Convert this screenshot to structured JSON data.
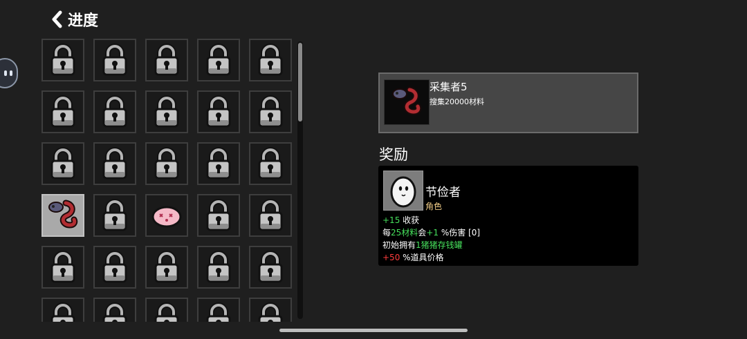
{
  "header": {
    "back_icon": "chevron-left-icon",
    "title": "进度"
  },
  "colors": {
    "background": "#1f1f1f",
    "positive": "#46e05c",
    "negative": "#ff3c3c",
    "type_label": "#f0cc87"
  },
  "grid": {
    "columns": 5,
    "cells": [
      "locked",
      "locked",
      "locked",
      "locked",
      "locked",
      "locked",
      "locked",
      "locked",
      "locked",
      "locked",
      "locked",
      "locked",
      "locked",
      "locked",
      "locked",
      "unlocked-tentacle",
      "locked",
      "unlocked-pink-creature",
      "locked",
      "locked",
      "locked",
      "locked",
      "locked",
      "locked",
      "locked",
      "locked",
      "locked",
      "locked",
      "locked",
      "locked"
    ]
  },
  "achievement": {
    "icon": "red-tentacle-icon",
    "name": "采集者5",
    "desc": "搜集20000材料"
  },
  "reward": {
    "heading": "奖励",
    "icon": "white-egg-character-icon",
    "name": "节俭者",
    "type": "角色",
    "stat1": {
      "value": "+15",
      "text": " 收获"
    },
    "stat2": {
      "t1": "每",
      "v1": "25材料",
      "t2": "会",
      "v2": "+1",
      "t3": " %伤害 [0]"
    },
    "stat3": {
      "t1": "初始拥有",
      "v1": "1猪猪存钱罐"
    },
    "stat4": {
      "value": "+50",
      "text": " %道具价格"
    }
  }
}
